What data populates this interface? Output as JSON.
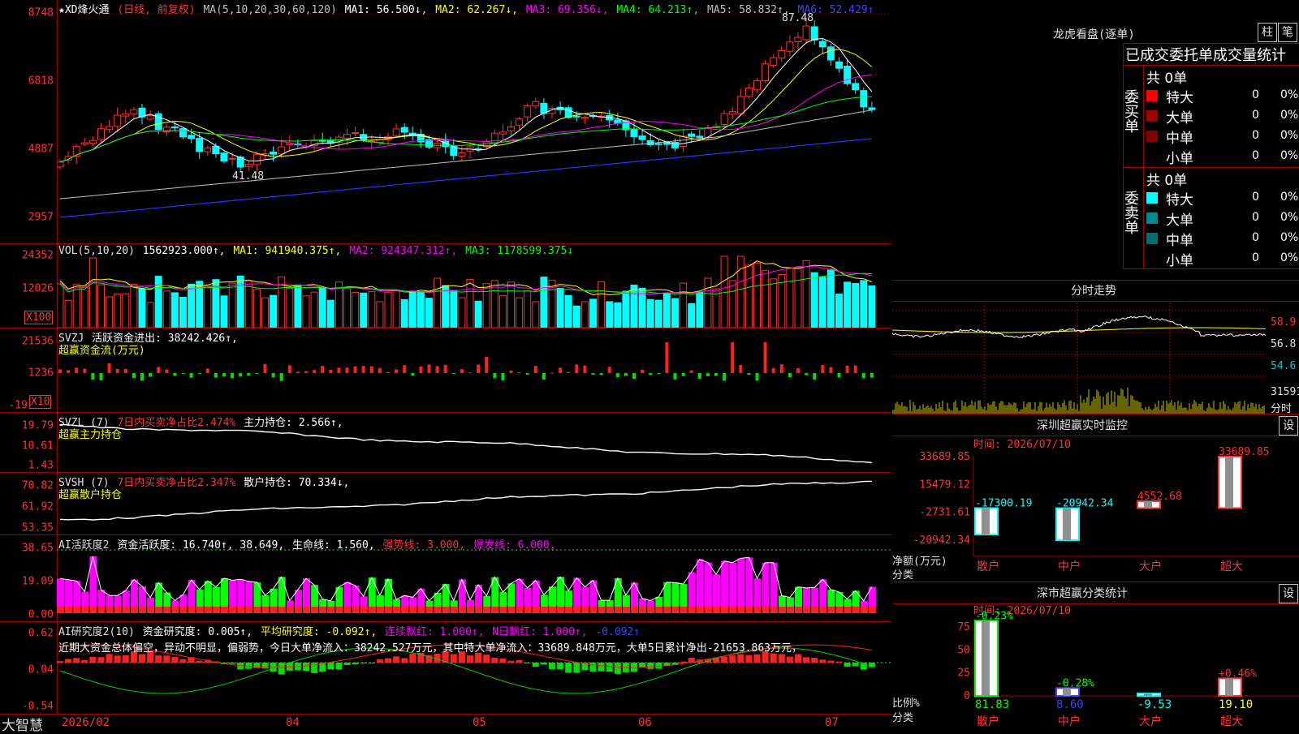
{
  "app": {
    "brand": "大智慧"
  },
  "main": {
    "stock_name": "★XD烽火通",
    "mode": "(日线, 前复权)",
    "ma_label": "MA(5,10,20,30,60,120)",
    "ma": [
      {
        "text": "MA1: 56.500↓,",
        "color": "#ffffff"
      },
      {
        "text": "MA2: 62.267↓,",
        "color": "#ffff00"
      },
      {
        "text": "MA3: 69.356↓,",
        "color": "#ff00ff"
      },
      {
        "text": "MA4: 64.213↑,",
        "color": "#00ff00"
      },
      {
        "text": "MA5: 58.832↑,",
        "color": "#c0c0c0"
      },
      {
        "text": "MA6: 52.429↑",
        "color": "#4040ff"
      }
    ],
    "y_labels": [
      "8748",
      "6818",
      "4887",
      "2957"
    ],
    "high_label": "87.48",
    "low_label": "41.48"
  },
  "vol": {
    "label": "VOL(5,10,20)",
    "value": "1562923.000↑,",
    "ma": [
      {
        "text": "MA1: 941940.375↑,",
        "color": "#ffff00"
      },
      {
        "text": "MA2: 924347.312↑,",
        "color": "#ff00ff"
      },
      {
        "text": "MA3: 1178599.375↓",
        "color": "#00ff00"
      }
    ],
    "y_labels": [
      "24352",
      "12026"
    ],
    "unit": "X100"
  },
  "svzj": {
    "label": "SVZJ",
    "text": "活跃资金进出: 38242.426↑,",
    "sub": "超赢资金流(万元)",
    "y_labels": [
      "21536",
      "1236",
      "-19"
    ],
    "unit": "X10"
  },
  "svzl": {
    "label": "SVZL (7)",
    "ratio": "7日内买卖净占比2.474%",
    "hold": "主力持仓: 2.566↑,",
    "sub": "超赢主力持仓",
    "y_labels": [
      "19.79",
      "10.61",
      "1.43"
    ]
  },
  "svsh": {
    "label": "SVSH (7)",
    "ratio": "7日内买卖净占比2.347%",
    "hold": "散户持仓: 70.334↓,",
    "sub": "超赢散户持仓",
    "y_labels": [
      "70.82",
      "61.92",
      "53.35"
    ]
  },
  "ai1": {
    "label": "AI活跃度2",
    "text": "资金活跃度: 16.740↑, 38.649,",
    "life": "生命线: 1.560,",
    "strong": "强势线: 3.000,",
    "burst": "爆发线: 6.000,",
    "y_labels": [
      "38.65",
      "19.09",
      "0.00"
    ]
  },
  "ai2": {
    "label": "AI研究度2(10)",
    "text": "资金研究度: 0.005↑,",
    "avg": "平均研究度: -0.092↑,",
    "streak": "连续飘红: 1.000↑,",
    "nday": "N日飘红: 1.000↑,",
    "last": "-0.092↑",
    "comment": "近期大资金总体偏空，异动不明显，偏弱势，今日大单净流入：38242.527万元，其中特大单净流入：33689.848万元，大单5日累计净出-21653.863万元，",
    "y_labels": [
      "0.62",
      "0.04",
      "-0.54"
    ]
  },
  "xaxis": [
    "2026/02",
    "04",
    "05",
    "06",
    "07"
  ],
  "lhb": {
    "title": "龙虎看盘(逐单)",
    "btn1": "柱",
    "btn2": "笔",
    "header": "已成交委托单成交量统计",
    "buy_label": "委买单",
    "sell_label": "委卖单",
    "buy_total": "共 0单",
    "sell_total": "共 0单",
    "buy_rows": [
      {
        "name": "特大",
        "n": "0",
        "p": "0%",
        "color": "#ff0000"
      },
      {
        "name": "大单",
        "n": "0",
        "p": "0%",
        "color": "#a00000"
      },
      {
        "name": "中单",
        "n": "0",
        "p": "0%",
        "color": "#800000"
      },
      {
        "name": "小单",
        "n": "0",
        "p": "0%",
        "color": ""
      }
    ],
    "sell_rows": [
      {
        "name": "特大",
        "n": "0",
        "p": "0%",
        "color": "#00ffff"
      },
      {
        "name": "大单",
        "n": "0",
        "p": "0%",
        "color": "#008b8b"
      },
      {
        "name": "中单",
        "n": "0",
        "p": "0%",
        "color": "#006e6e"
      },
      {
        "name": "小单",
        "n": "0",
        "p": "0%",
        "color": ""
      }
    ]
  },
  "intraday": {
    "title": "分时走势",
    "y_labels": [
      "58.9",
      "56.8",
      "54.6",
      "31591",
      "分时"
    ]
  },
  "sz_monitor": {
    "title": "深圳超赢实时监控",
    "btn": "设",
    "time": "时间: 2026/07/10",
    "y_labels": [
      "33689.85",
      "15479.12",
      "-2731.61",
      "-20942.34"
    ],
    "y_title": "净额(万元)",
    "x_title": "分类",
    "cats": [
      "散户",
      "中户",
      "大户",
      "超大"
    ]
  },
  "sz_class": {
    "title": "深市超赢分类统计",
    "btn": "设",
    "time": "时间: 2026/07/10",
    "y_labels": [
      "75",
      "50",
      "25",
      "0"
    ],
    "y_title": "比例%",
    "x_title": "分类",
    "cats": [
      "散户",
      "中户",
      "大户",
      "超大"
    ]
  },
  "chart_data": [
    {
      "type": "bar",
      "name": "深圳超赢实时监控",
      "categories": [
        "散户",
        "中户",
        "大户",
        "超大"
      ],
      "values": [
        -17300.19,
        -20942.34,
        4552.68,
        33689.85
      ],
      "value_labels": [
        "-17300.19",
        "-20942.34",
        "4552.68",
        "33689.85"
      ],
      "ylim": [
        -20942.34,
        33689.85
      ]
    },
    {
      "type": "bar",
      "name": "深市超赢分类统计",
      "categories": [
        "散户",
        "中户",
        "大户",
        "超大"
      ],
      "values": [
        81.83,
        8.6,
        -9.53,
        19.1
      ],
      "value_labels": [
        "81.83",
        "8.60",
        "-9.53",
        "19.10"
      ],
      "change_labels": [
        "-0.23%",
        "-0.28%",
        "",
        "+0.46%"
      ],
      "ylim": [
        0,
        75
      ]
    }
  ]
}
